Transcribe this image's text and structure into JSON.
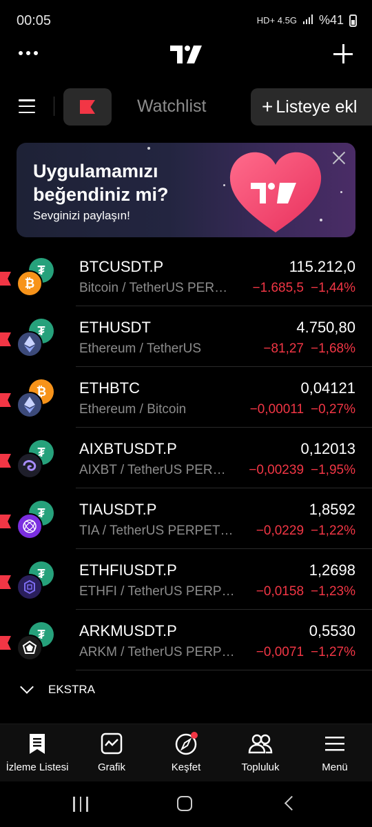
{
  "status_bar": {
    "time": "00:05",
    "network": "HD+ 4.5G",
    "battery": "%41"
  },
  "toolbar": {
    "watchlist_tab": "Watchlist",
    "add_list_label": "Listeye ekl"
  },
  "banner": {
    "title": "Uygulamamızı beğendiniz mi?",
    "subtitle": "Sevginizi paylaşın!"
  },
  "watchlist": [
    {
      "symbol": "BTCUSDT.P",
      "description": "Bitcoin / TetherUS PER…",
      "price": "115.212,0",
      "change": "−1.685,5",
      "change_pct": "−1,44%",
      "base_icon": "bitcoin-icon",
      "quote_icon": "tether-icon"
    },
    {
      "symbol": "ETHUSDT",
      "description": "Ethereum / TetherUS",
      "price": "4.750,80",
      "change": "−81,27",
      "change_pct": "−1,68%",
      "base_icon": "ethereum-icon",
      "quote_icon": "tether-icon"
    },
    {
      "symbol": "ETHBTC",
      "description": "Ethereum / Bitcoin",
      "price": "0,04121",
      "change": "−0,00011",
      "change_pct": "−0,27%",
      "base_icon": "ethereum-icon",
      "quote_icon": "bitcoin-icon"
    },
    {
      "symbol": "AIXBTUSDT.P",
      "description": "AIXBT / TetherUS PER…",
      "price": "0,12013",
      "change": "−0,00239",
      "change_pct": "−1,95%",
      "base_icon": "aixbt-icon",
      "quote_icon": "tether-icon"
    },
    {
      "symbol": "TIAUSDT.P",
      "description": "TIA / TetherUS PERPET…",
      "price": "1,8592",
      "change": "−0,0229",
      "change_pct": "−1,22%",
      "base_icon": "celestia-icon",
      "quote_icon": "tether-icon"
    },
    {
      "symbol": "ETHFIUSDT.P",
      "description": "ETHFI / TetherUS PERP…",
      "price": "1,2698",
      "change": "−0,0158",
      "change_pct": "−1,23%",
      "base_icon": "etherfi-icon",
      "quote_icon": "tether-icon"
    },
    {
      "symbol": "ARKMUSDT.P",
      "description": "ARKM / TetherUS PERP…",
      "price": "0,5530",
      "change": "−0,0071",
      "change_pct": "−1,27%",
      "base_icon": "arkham-icon",
      "quote_icon": "tether-icon"
    }
  ],
  "section": {
    "ekstra_label": "EKSTRA"
  },
  "bottom_nav": [
    {
      "label": "İzleme Listesi",
      "icon": "watchlist-icon"
    },
    {
      "label": "Grafik",
      "icon": "chart-icon"
    },
    {
      "label": "Keşfet",
      "icon": "compass-icon"
    },
    {
      "label": "Topluluk",
      "icon": "community-icon"
    },
    {
      "label": "Menü",
      "icon": "menu-icon"
    }
  ],
  "colors": {
    "negative": "#f23645",
    "tether": "#26a17b",
    "bitcoin": "#f7931a",
    "ethereum": "#627eea",
    "background": "#000000"
  }
}
